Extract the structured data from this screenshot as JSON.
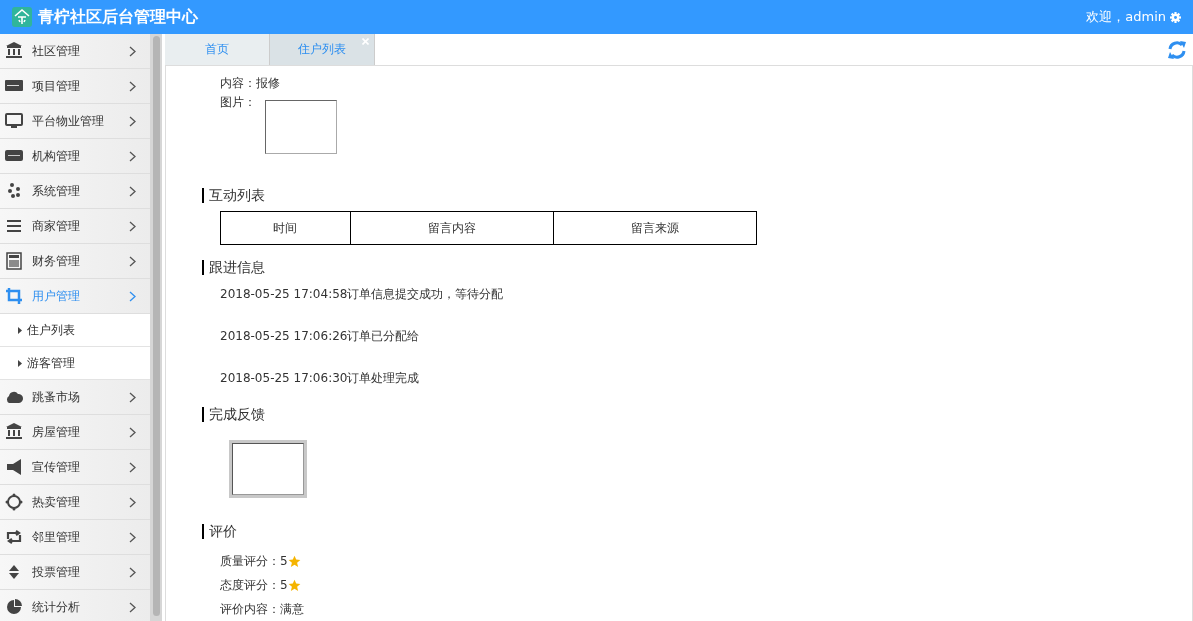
{
  "header": {
    "title": "青柠社区后台管理中心",
    "welcome": "欢迎，admin"
  },
  "sidebar": {
    "items": [
      {
        "label": "社区管理",
        "selected": false
      },
      {
        "label": "项目管理",
        "selected": false
      },
      {
        "label": "平台物业管理",
        "selected": false
      },
      {
        "label": "机构管理",
        "selected": false
      },
      {
        "label": "系统管理",
        "selected": false
      },
      {
        "label": "商家管理",
        "selected": false
      },
      {
        "label": "财务管理",
        "selected": false
      },
      {
        "label": "用户管理",
        "selected": true,
        "children": [
          {
            "label": "住户列表",
            "selected": false
          },
          {
            "label": "游客管理",
            "selected": false
          }
        ]
      },
      {
        "label": "跳蚤市场",
        "selected": false
      },
      {
        "label": "房屋管理",
        "selected": false
      },
      {
        "label": "宣传管理",
        "selected": false
      },
      {
        "label": "热卖管理",
        "selected": false
      },
      {
        "label": "邻里管理",
        "selected": false
      },
      {
        "label": "投票管理",
        "selected": false
      },
      {
        "label": "统计分析",
        "selected": false
      }
    ]
  },
  "tabs": [
    {
      "label": "首页",
      "selected": false,
      "closable": false
    },
    {
      "label": "住户列表",
      "selected": true,
      "closable": true
    }
  ],
  "detail": {
    "content": "内容：报修",
    "image_label": "图片："
  },
  "sections": [
    {
      "kind": "table",
      "title": "互动列表",
      "columns": [
        "时间",
        "留言内容",
        "留言来源"
      ]
    },
    {
      "kind": "log",
      "title": "跟进信息",
      "entries": [
        "2018-05-25 17:04:58订单信息提交成功，等待分配",
        "2018-05-25 17:06:26订单已分配给",
        "2018-05-25 17:06:30订单处理完成"
      ]
    },
    {
      "kind": "image",
      "title": "完成反馈"
    },
    {
      "kind": "rating",
      "title": "评价",
      "lines": [
        {
          "kind": "score",
          "text": "质量评分：5"
        },
        {
          "kind": "score",
          "text": "态度评分：5"
        },
        {
          "kind": "comment",
          "text": "评价内容：满意"
        }
      ]
    }
  ]
}
